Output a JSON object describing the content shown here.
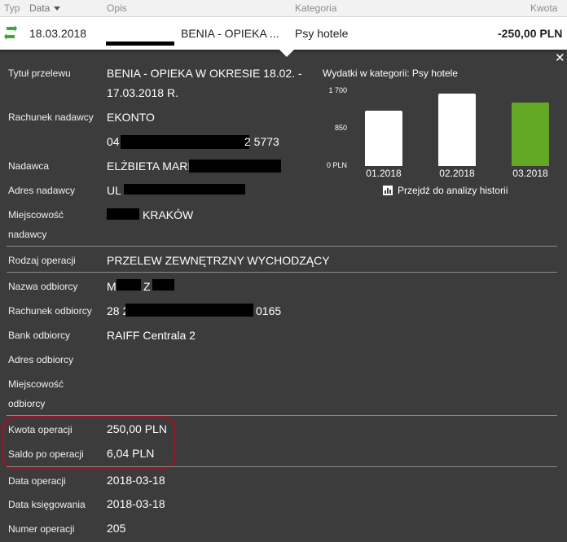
{
  "header": {
    "typ": "Typ",
    "data": "Data",
    "opis": "Opis",
    "kategoria": "Kategoria",
    "kwota": "Kwota"
  },
  "transaction": {
    "date": "18.03.2018",
    "description": "BENIA - OPIEKA ...",
    "category": "Psy hotele",
    "amount": "-250,00 PLN",
    "icon": "transfer-arrows-icon",
    "icon_color": "#3aa935"
  },
  "details": {
    "tytul_label": "Tytuł przelewu",
    "tytul_line1": "BENIA - OPIEKA W OKRESIE 18.02. -",
    "tytul_line2": "17.03.2018 R.",
    "rachunek_nadawcy_label": "Rachunek nadawcy",
    "rachunek_nadawcy_name": "EKONTO",
    "rachunek_nadawcy_start": "04",
    "rachunek_nadawcy_end": "2 5773",
    "nadawca_label": "Nadawca",
    "nadawca_value": "ELŻBIETA MARIA",
    "adres_nadawcy_label": "Adres nadawcy",
    "adres_nadawcy_value": "UL",
    "miejscowosc_nadawcy_label1": "Miejscowość",
    "miejscowosc_nadawcy_label2": "nadawcy",
    "miejscowosc_nadawcy_value": "KRAKÓW",
    "rodzaj_label": "Rodzaj operacji",
    "rodzaj_value": "PRZELEW ZEWNĘTRZNY WYCHODZĄCY",
    "nazwa_odbiorcy_label": "Nazwa odbiorcy",
    "nazwa_odbiorcy_m": "M",
    "nazwa_odbiorcy_z": "Z",
    "rachunek_odbiorcy_label": "Rachunek odbiorcy",
    "rachunek_odbiorcy_start": "28 2",
    "rachunek_odbiorcy_end": "0165",
    "bank_label": "Bank odbiorcy",
    "bank_value": "RAIFF Centrala 2",
    "adres_odbiorcy_label": "Adres odbiorcy",
    "miejscowosc_odbiorcy_label1": "Miejscowość",
    "miejscowosc_odbiorcy_label2": "odbiorcy",
    "kwota_label": "Kwota operacji",
    "kwota_value": "250,00 PLN",
    "saldo_label": "Saldo po operacji",
    "saldo_value": "6,04 PLN",
    "data_op_label": "Data operacji",
    "data_op_value": "2018-03-18",
    "data_ks_label": "Data księgowania",
    "data_ks_value": "2018-03-18",
    "numer_label": "Numer operacji",
    "numer_value": "205"
  },
  "chart_data": {
    "type": "bar",
    "title": "Wydatki w kategorii:  Psy hotele",
    "categories": [
      "01.2018",
      "02.2018",
      "03.2018"
    ],
    "values": [
      1250,
      1650,
      1450
    ],
    "yticks": [
      "1 700",
      "850",
      "0 PLN"
    ],
    "ylim": [
      0,
      1700
    ],
    "colors": [
      "#ffffff",
      "#ffffff",
      "#63a824"
    ],
    "history_link": "Przejdź do analizy historii"
  },
  "colors": {
    "panel_bg": "#3c3c3c",
    "highlight": "#8b1a2b",
    "accent_green": "#63a824"
  }
}
